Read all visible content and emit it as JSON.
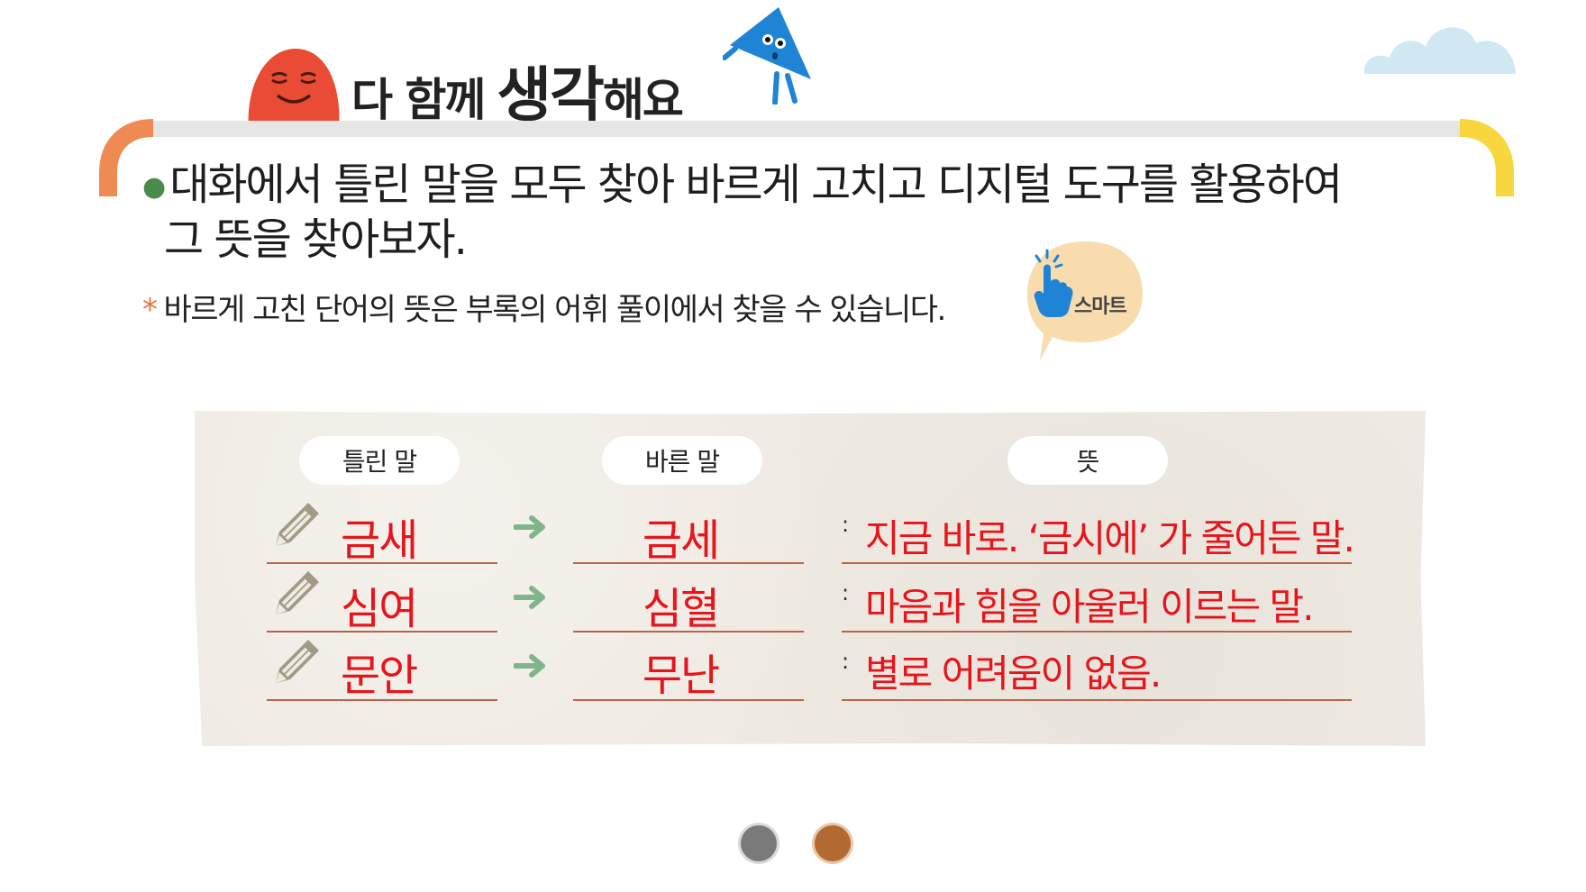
{
  "header": {
    "title_part1": "다 함께",
    "title_part2": "생각",
    "title_part3": "해요"
  },
  "instructions": {
    "line1": "대화에서 틀린 말을 모두 찾아 바르게 고치고 디지털 도구를 활용하여",
    "line2": "그 뜻을 찾아보자.",
    "note_star": "*",
    "note": "바르게 고친 단어의 뜻은 부록의 어휘 풀이에서 찾을 수 있습니다."
  },
  "smart_button": {
    "label": "스마트"
  },
  "table": {
    "headers": {
      "wrong": "틀린 말",
      "right": "바른 말",
      "meaning": "뜻"
    },
    "colon": ":",
    "rows": [
      {
        "wrong": "금새",
        "right": "금세",
        "meaning": "지금 바로. ‘금시에’ 가 줄어든 말."
      },
      {
        "wrong": "심여",
        "right": "심혈",
        "meaning": "마음과 힘을 아울러 이르는 말."
      },
      {
        "wrong": "문안",
        "right": "무난",
        "meaning": "별로 어려움이 없음."
      }
    ]
  },
  "colors": {
    "answer_red": "#e8141b",
    "arrow_green": "#7fb58a",
    "frame_left_orange": "#ef8a52",
    "frame_right_yellow": "#f7d63e",
    "dot_gray": "#7a7a7a",
    "dot_brown": "#b26a32"
  },
  "icons": [
    "pencil-icon",
    "arrow-right-icon",
    "pointer-hand-icon"
  ],
  "pagination": {
    "pages": 2,
    "current": 2
  }
}
